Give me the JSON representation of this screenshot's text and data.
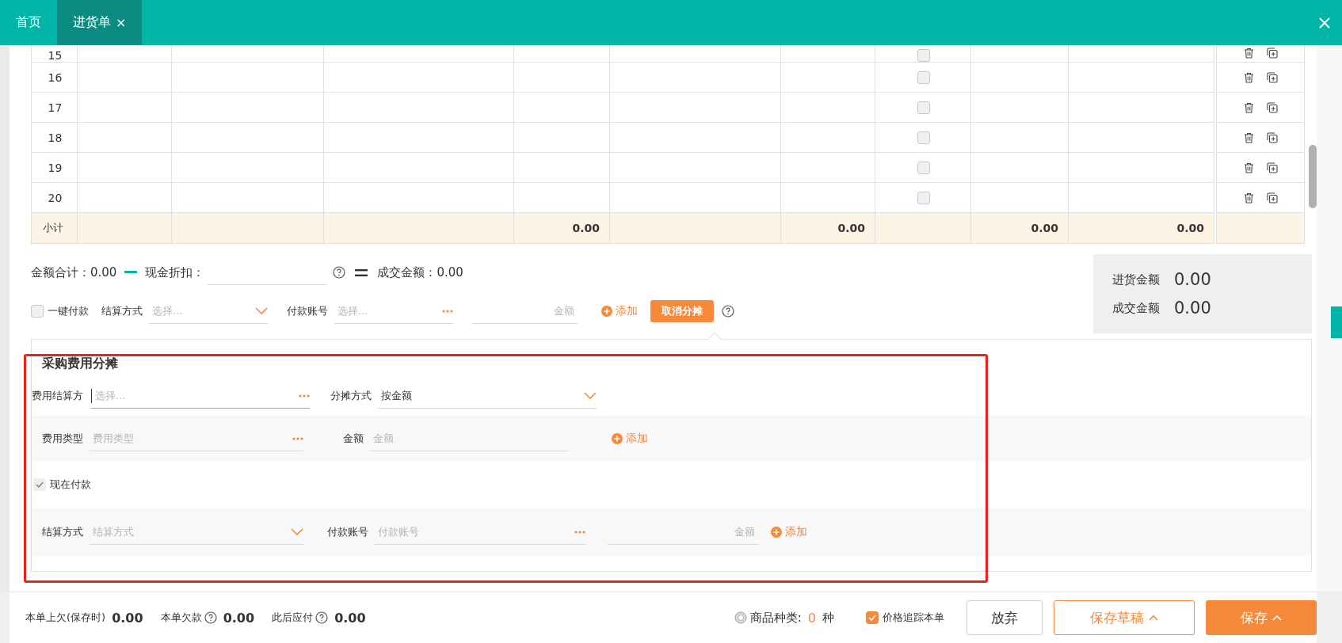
{
  "tabs": [
    {
      "label": "首页",
      "selected": false
    },
    {
      "label": "进货单",
      "selected": true,
      "close": "×"
    }
  ],
  "table": {
    "rows": [
      {
        "index": "15",
        "checked": false
      },
      {
        "index": "16",
        "checked": false
      },
      {
        "index": "17",
        "checked": false
      },
      {
        "index": "18",
        "checked": false
      },
      {
        "index": "19",
        "checked": false
      },
      {
        "index": "20",
        "checked": false
      }
    ],
    "subtotal": {
      "label": "小计",
      "cells": [
        null,
        null,
        null,
        "0.00",
        null,
        "0.00",
        null,
        "0.00",
        "0.00"
      ]
    }
  },
  "summary": {
    "total_label": "金额合计：",
    "total": "0.00",
    "discount_label": "现金折扣：",
    "deal_label": "成交金额：",
    "deal": "0.00"
  },
  "payment": {
    "one_click": {
      "label": "一键付款",
      "checked": false
    },
    "method_label": "结算方式",
    "method_placeholder": "选择...",
    "account_label": "付款账号",
    "account_placeholder": "选择...",
    "amount_placeholder": "金额",
    "add": "添加",
    "cancel_button": "取消分摊"
  },
  "totals": [
    {
      "label": "进货金额",
      "value": "0.00"
    },
    {
      "label": "成交金额",
      "value": "0.00"
    }
  ],
  "allocation": {
    "title": "采购费用分摊",
    "payer_label": "费用结算方",
    "payer_placeholder": "选择...",
    "method_label": "分摊方式",
    "method_value": "按金额",
    "fee": {
      "type_label": "费用类型",
      "type_placeholder": "费用类型",
      "amount_label": "金额",
      "amount_placeholder": "金额",
      "add": "添加"
    },
    "pay_now": {
      "label": "现在付款",
      "checked": true
    },
    "pay": {
      "method_label": "结算方式",
      "method_placeholder": "结算方式",
      "account_label": "付款账号",
      "account_placeholder": "付款账号",
      "amount_placeholder": "金额",
      "add": "添加"
    }
  },
  "footer": {
    "balances": [
      {
        "label": "本单上欠(保存时)",
        "value": "0.00",
        "help": false
      },
      {
        "label": "本单欠款",
        "value": "0.00",
        "help": true
      },
      {
        "label": "此后应付",
        "value": "0.00",
        "help": true
      }
    ],
    "kinds": {
      "label": "商品种类:",
      "count": "0",
      "unit": "种"
    },
    "track": {
      "label": "价格追踪本单",
      "checked": true
    },
    "buttons": [
      {
        "label": "放弃",
        "kind": "plain",
        "caret": false
      },
      {
        "label": "保存草稿",
        "kind": "outline",
        "caret": true
      },
      {
        "label": "保存",
        "kind": "primary",
        "caret": true
      }
    ]
  }
}
